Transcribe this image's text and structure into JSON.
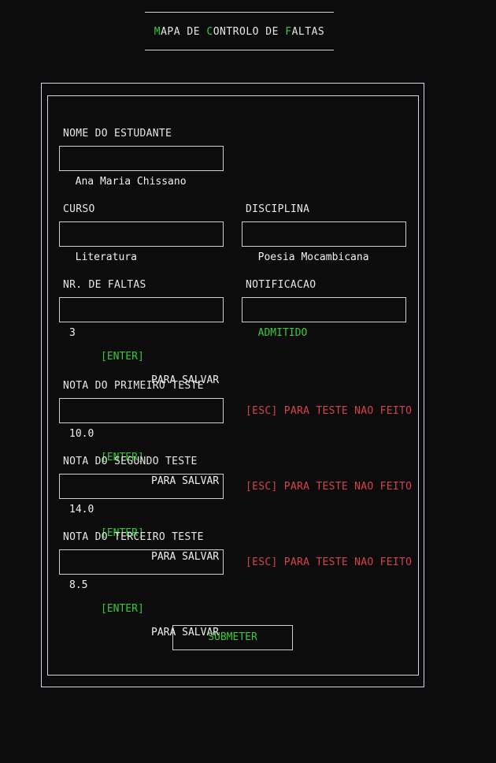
{
  "header": {
    "title_parts": [
      {
        "accent": "M",
        "rest": "APA DE "
      },
      {
        "accent": "C",
        "rest": "ONTROLO DE "
      },
      {
        "accent": "F",
        "rest": "ALTAS"
      }
    ]
  },
  "form": {
    "student_name": {
      "label": "NOME DO ESTUDANTE",
      "value": "Ana Maria Chissano"
    },
    "course": {
      "label": "CURSO",
      "value": "Literatura"
    },
    "subject": {
      "label": "DISCIPLINA",
      "value": "Poesia Mocambicana"
    },
    "absences": {
      "label": "NR. DE FALTAS",
      "value": "3",
      "key_hint": "[ENTER]",
      "hint_text": "PARA SALVAR"
    },
    "notification": {
      "label": "NOTIFICACAO",
      "value": "ADMITIDO"
    },
    "test1": {
      "label": "NOTA DO PRIMEIRO TESTE",
      "value": "10.0",
      "key_hint": "[ENTER]",
      "hint_text": "PARA SALVAR",
      "esc_hint": "[ESC] PARA TESTE NAO FEITO"
    },
    "test2": {
      "label": "NOTA DO SEGUNDO TESTE",
      "value": "14.0",
      "key_hint": "[ENTER]",
      "hint_text": "PARA SALVAR",
      "esc_hint": "[ESC] PARA TESTE NAO FEITO"
    },
    "test3": {
      "label": "NOTA DO TERCEIRO TESTE",
      "value": "8.5",
      "key_hint": "[ENTER]",
      "hint_text": "PARA SALVAR",
      "esc_hint": "[ESC] PARA TESTE NAO FEITO"
    },
    "submit_label": "SUBMETER"
  },
  "colors": {
    "background": "#0c0c0c",
    "accent_green": "#3cc83c",
    "escape_red": "#d9414b",
    "border": "#d0d0d0"
  }
}
